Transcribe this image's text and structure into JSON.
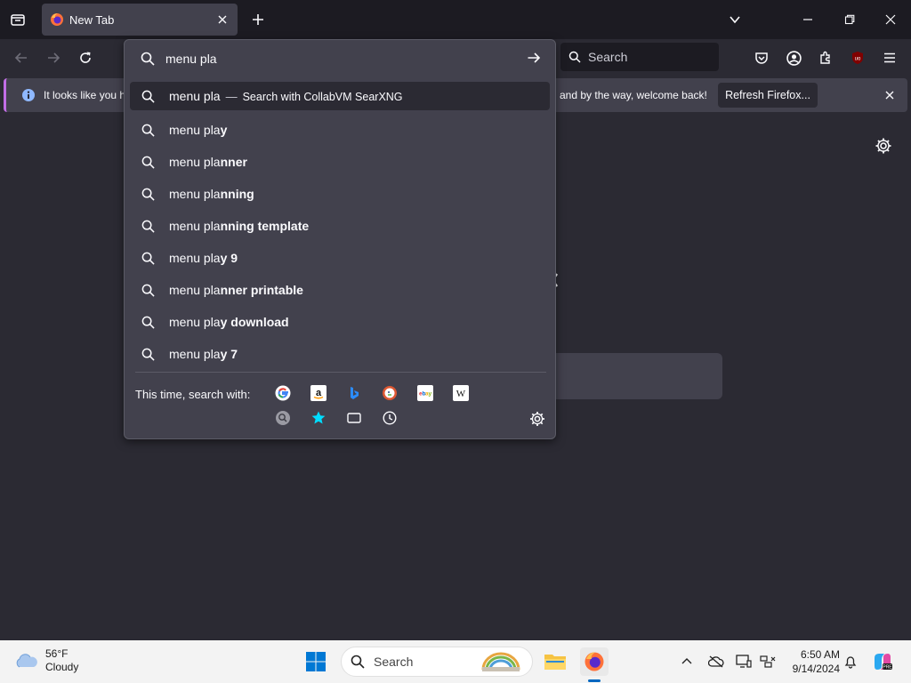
{
  "browser": {
    "tab": {
      "title": "New Tab"
    },
    "toolbar": {
      "search_placeholder": "Search"
    }
  },
  "notification": {
    "message_left": "It looks like you ha",
    "message_right": "and by the way, welcome back!",
    "button_label": "Refresh Firefox..."
  },
  "urlbar": {
    "value": "menu pla",
    "results": [
      {
        "prefix": "menu pla",
        "bold": "",
        "action": "Search with CollabVM SearXNG"
      },
      {
        "prefix": "menu pla",
        "bold": "y",
        "action": ""
      },
      {
        "prefix": "menu pla",
        "bold": "nner",
        "action": ""
      },
      {
        "prefix": "menu pla",
        "bold": "nning",
        "action": ""
      },
      {
        "prefix": "menu pla",
        "bold": "nning template",
        "action": ""
      },
      {
        "prefix": "menu pla",
        "bold": "y 9",
        "action": ""
      },
      {
        "prefix": "menu pla",
        "bold": "nner printable",
        "action": ""
      },
      {
        "prefix": "menu pla",
        "bold": "y download",
        "action": ""
      },
      {
        "prefix": "menu pla",
        "bold": "y 7",
        "action": ""
      }
    ],
    "oneoff_label": "This time, search with:",
    "engines": [
      "google-icon",
      "amazon-icon",
      "bing-icon",
      "duckduckgo-icon",
      "ebay-icon",
      "wikipedia-icon",
      "searxng-icon",
      "bookmarks-icon",
      "tabs-icon",
      "history-icon"
    ]
  },
  "taskbar": {
    "weather_temp": "56°F",
    "weather_desc": "Cloudy",
    "search_placeholder": "Search",
    "time": "6:50 AM",
    "date": "9/14/2024"
  },
  "colors": {
    "accent": "#c26ee6",
    "panel": "#42414d",
    "background": "#2b2a33",
    "tabstrip": "#1c1b22"
  }
}
